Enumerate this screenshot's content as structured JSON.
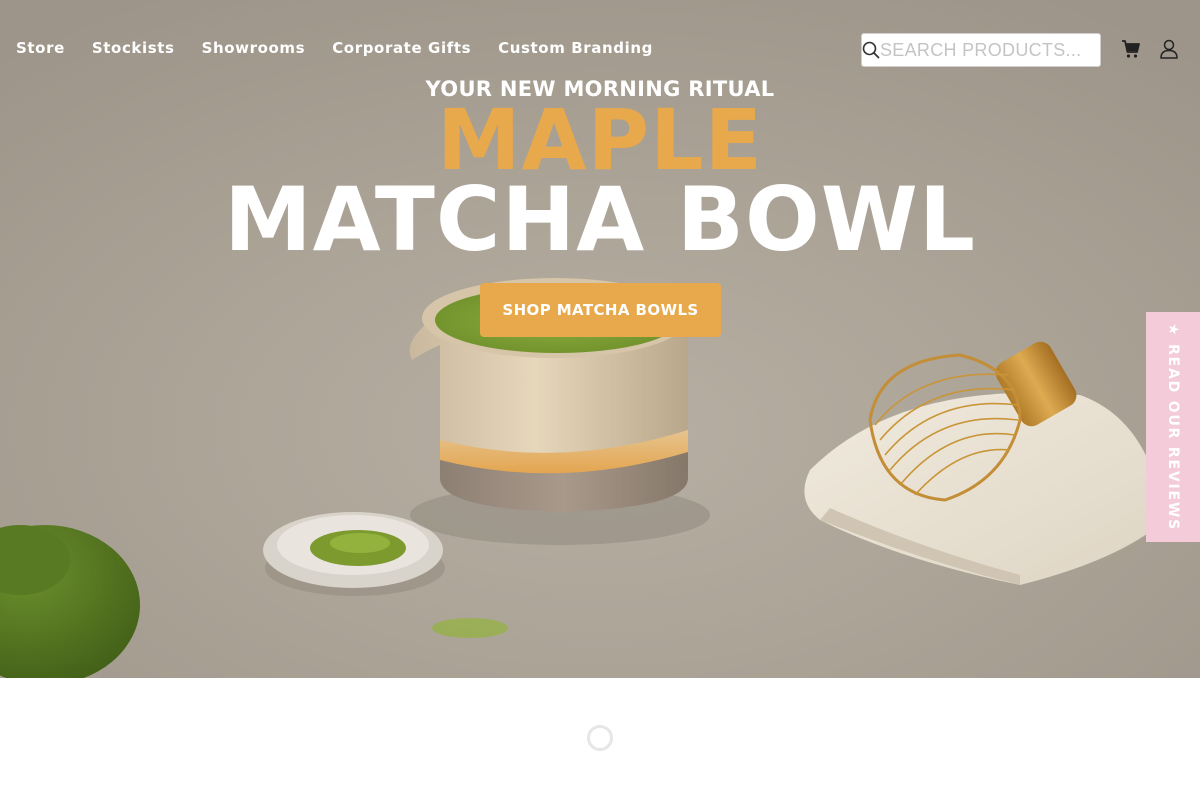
{
  "nav": {
    "links": [
      "Store",
      "Stockists",
      "Showrooms",
      "Corporate Gifts",
      "Custom Branding"
    ],
    "search": {
      "placeholder": "SEARCH PRODUCTS..."
    },
    "icons": {
      "search": "search-icon",
      "cart": "cart-icon",
      "account": "account-icon"
    }
  },
  "hero": {
    "eyebrow": "YOUR NEW MORNING RITUAL",
    "title_accent": "MAPLE",
    "title": "MATCHA BOWL",
    "cta_label": "SHOP MATCHA BOWLS"
  },
  "reviews_tab": {
    "label": "★ READ OUR REVIEWS"
  },
  "colors": {
    "accent": "#e7a94b",
    "reviews_tab": "#f3cbd9",
    "background_hero": "#aca497"
  }
}
